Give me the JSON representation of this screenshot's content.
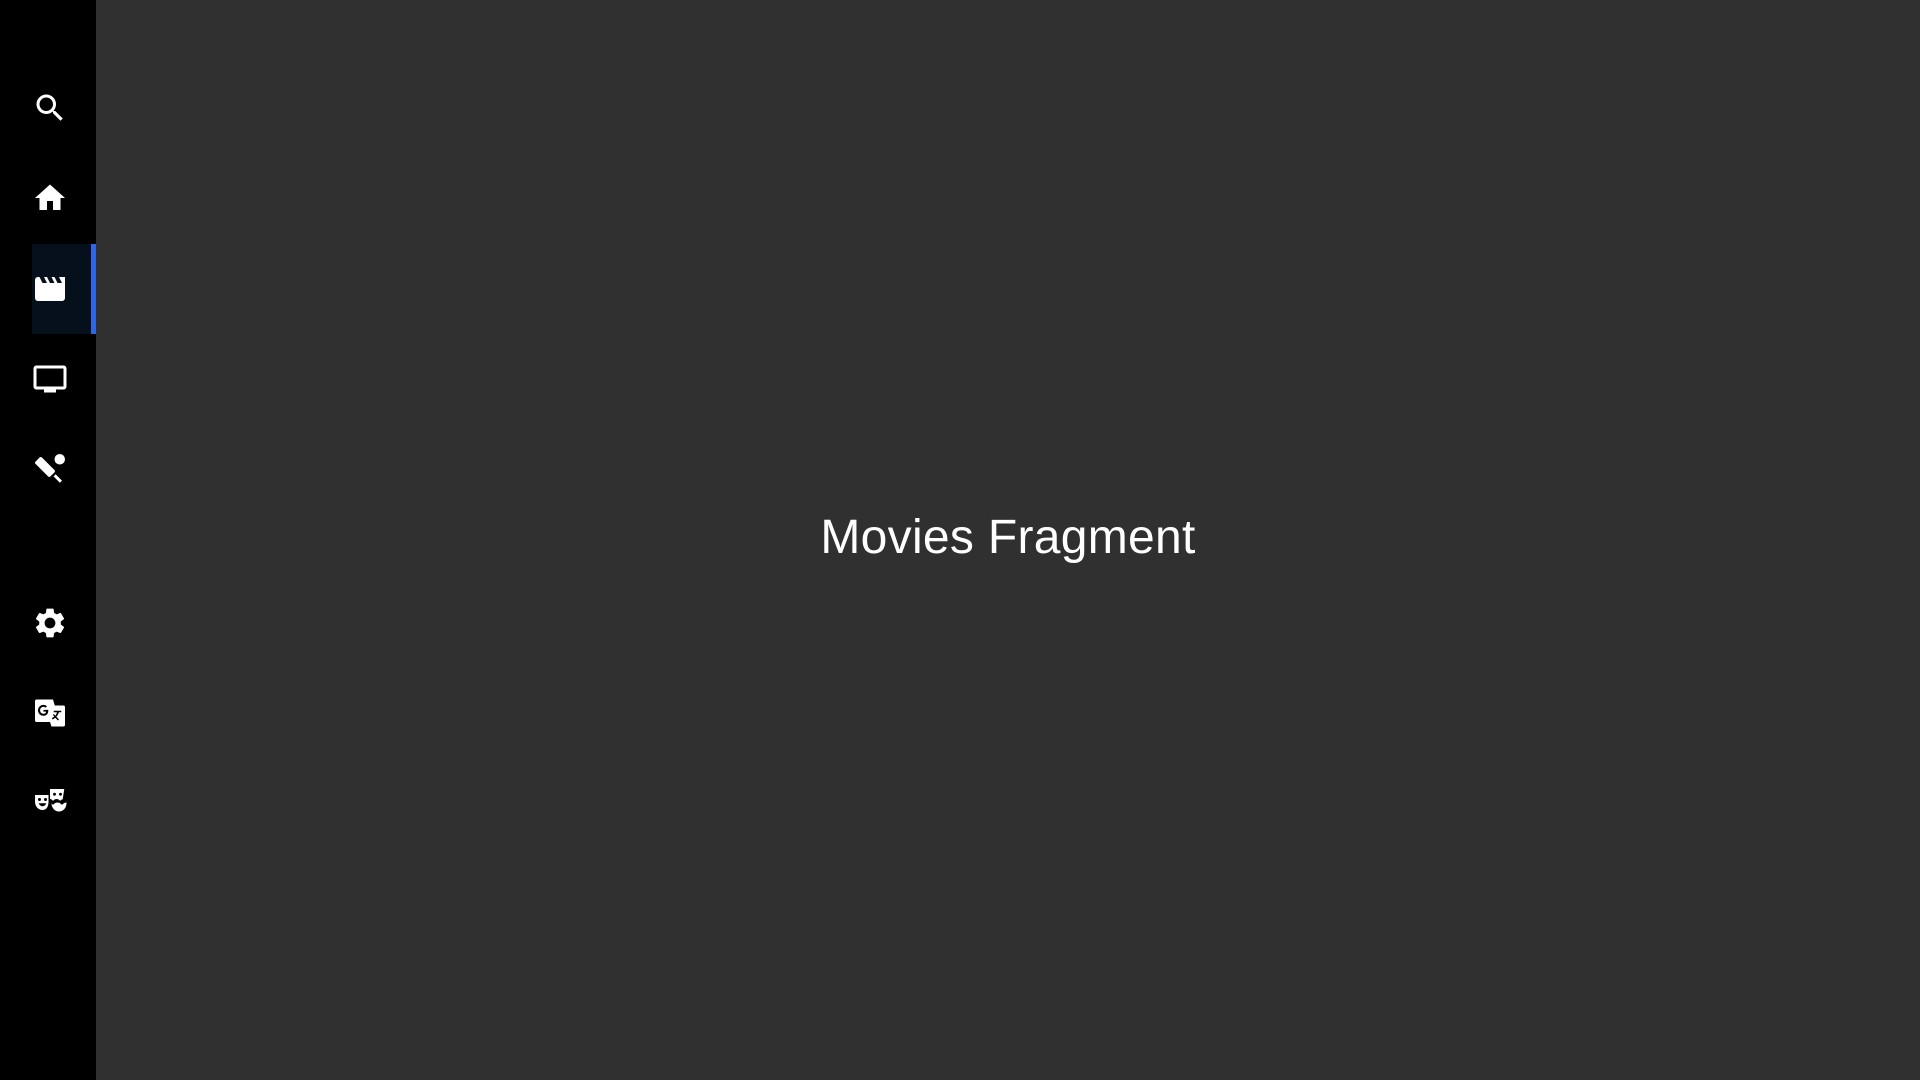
{
  "sidebar": {
    "items": [
      {
        "id": "search",
        "label": "Search",
        "icon": "search-icon",
        "active": false
      },
      {
        "id": "home",
        "label": "Home",
        "icon": "home-icon",
        "active": false
      },
      {
        "id": "movies",
        "label": "Movies",
        "icon": "movie-clapperboard-icon",
        "active": true
      },
      {
        "id": "tv",
        "label": "TV",
        "icon": "tv-icon",
        "active": false
      },
      {
        "id": "sports",
        "label": "Sports",
        "icon": "sports-cricket-icon",
        "active": false
      },
      {
        "id": "settings",
        "label": "Settings",
        "icon": "gear-icon",
        "active": false
      },
      {
        "id": "language",
        "label": "Language",
        "icon": "translate-icon",
        "active": false
      },
      {
        "id": "genres",
        "label": "Genres",
        "icon": "theater-masks-icon",
        "active": false
      }
    ],
    "active_indicator_color": "#2f66e6",
    "background": "#000000"
  },
  "main": {
    "title": "Movies Fragment",
    "background": "#303030",
    "text_color": "#ffffff"
  }
}
